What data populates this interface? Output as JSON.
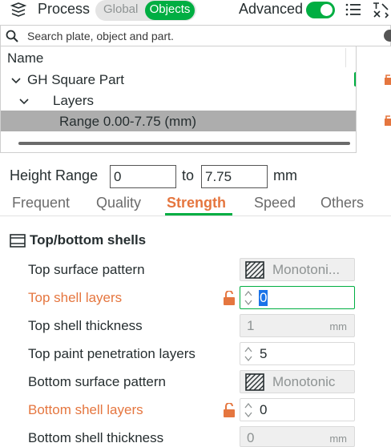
{
  "topbar": {
    "title": "Process",
    "seg_global": "Global",
    "seg_objects": "Objects",
    "advanced_label": "Advanced",
    "advanced_on": true
  },
  "search": {
    "placeholder": "Search plate, object and part."
  },
  "tree": {
    "header": "Name",
    "part": "GH Square Part",
    "layers": "Layers",
    "range": "Range 0.00-7.75 (mm)"
  },
  "height_range": {
    "label": "Height Range",
    "from": "0",
    "to_label": "to",
    "to": "7.75",
    "unit": "mm"
  },
  "tabs": [
    {
      "label": "Frequent"
    },
    {
      "label": "Quality"
    },
    {
      "label": "Strength",
      "active": true
    },
    {
      "label": "Speed"
    },
    {
      "label": "Others"
    }
  ],
  "section": {
    "title": "Top/bottom shells"
  },
  "options": [
    {
      "label": "Top surface pattern",
      "type": "combo",
      "value": "Monotoni...",
      "modified": false
    },
    {
      "label": "Top shell layers",
      "type": "spin",
      "value": "0",
      "modified": true,
      "focused": true
    },
    {
      "label": "Top shell thickness",
      "type": "spin",
      "value": "1",
      "unit": "mm",
      "modified": false,
      "disabled": true
    },
    {
      "label": "Top paint penetration layers",
      "type": "spin",
      "value": "5",
      "modified": false
    },
    {
      "label": "Bottom surface pattern",
      "type": "combo",
      "value": "Monotonic",
      "modified": false
    },
    {
      "label": "Bottom shell layers",
      "type": "spin",
      "value": "0",
      "modified": true
    },
    {
      "label": "Bottom shell thickness",
      "type": "spin",
      "value": "0",
      "unit": "mm",
      "modified": false,
      "disabled": true
    }
  ],
  "colors": {
    "accent": "#00ae42",
    "modified": "#e5763f",
    "selection": "#adadad"
  }
}
